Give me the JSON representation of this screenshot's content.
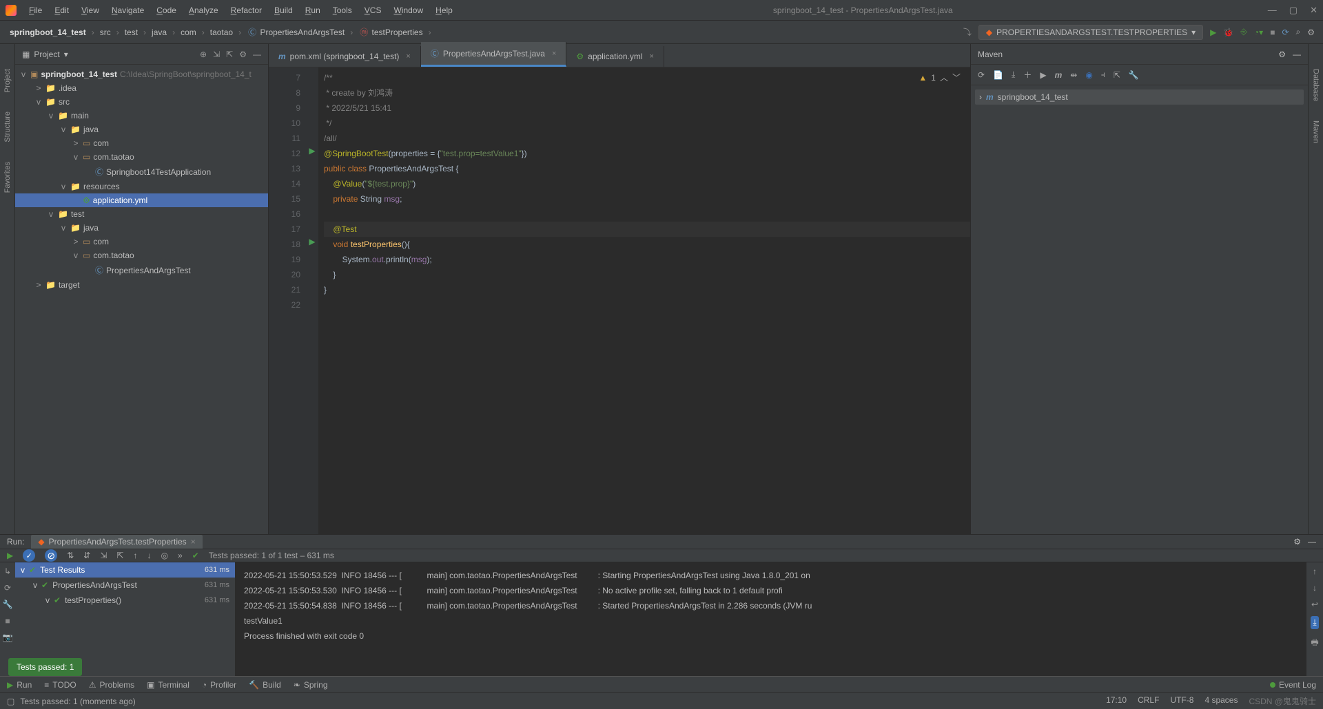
{
  "menu": [
    "File",
    "Edit",
    "View",
    "Navigate",
    "Code",
    "Analyze",
    "Refactor",
    "Build",
    "Run",
    "Tools",
    "VCS",
    "Window",
    "Help"
  ],
  "window_title": "springboot_14_test - PropertiesAndArgsTest.java",
  "breadcrumbs": [
    "springboot_14_test",
    "src",
    "test",
    "java",
    "com",
    "taotao",
    "PropertiesAndArgsTest",
    "testProperties"
  ],
  "run_config": "PROPERTIESANDARGSTEST.TESTPROPERTIES",
  "project": {
    "title": "Project",
    "root": {
      "name": "springboot_14_test",
      "path": "C:\\Idea\\SpringBoot\\springboot_14_t"
    },
    "nodes": [
      {
        "depth": 1,
        "arr": ">",
        "icon": "fldr",
        "label": ".idea"
      },
      {
        "depth": 1,
        "arr": "v",
        "icon": "fldb",
        "label": "src"
      },
      {
        "depth": 2,
        "arr": "v",
        "icon": "fldb",
        "label": "main"
      },
      {
        "depth": 3,
        "arr": "v",
        "icon": "fldb",
        "label": "java"
      },
      {
        "depth": 4,
        "arr": ">",
        "icon": "pkg",
        "label": "com"
      },
      {
        "depth": 4,
        "arr": "v",
        "icon": "pkg",
        "label": "com.taotao"
      },
      {
        "depth": 5,
        "arr": "",
        "icon": "cls",
        "label": "Springboot14TestApplication"
      },
      {
        "depth": 3,
        "arr": "v",
        "icon": "fldr",
        "label": "resources"
      },
      {
        "depth": 4,
        "arr": "",
        "icon": "yml",
        "label": "application.yml",
        "sel": true
      },
      {
        "depth": 2,
        "arr": "v",
        "icon": "fldb",
        "label": "test"
      },
      {
        "depth": 3,
        "arr": "v",
        "icon": "fldb",
        "label": "java"
      },
      {
        "depth": 4,
        "arr": ">",
        "icon": "pkg",
        "label": "com"
      },
      {
        "depth": 4,
        "arr": "v",
        "icon": "pkg",
        "label": "com.taotao"
      },
      {
        "depth": 5,
        "arr": "",
        "icon": "cls",
        "label": "PropertiesAndArgsTest"
      },
      {
        "depth": 1,
        "arr": ">",
        "icon": "fldr",
        "label": "target"
      }
    ]
  },
  "tabs": [
    {
      "icon": "m",
      "label": "pom.xml (springboot_14_test)",
      "active": false
    },
    {
      "icon": "c",
      "label": "PropertiesAndArgsTest.java",
      "active": true
    },
    {
      "icon": "y",
      "label": "application.yml",
      "active": false
    }
  ],
  "inspection": {
    "warn": "1"
  },
  "code_start": 7,
  "code": [
    {
      "n": 7,
      "run": "",
      "html": "<span class='cmt'>/**</span>"
    },
    {
      "n": 8,
      "run": "",
      "html": "<span class='cmt'> * create by 刘鸿涛</span>"
    },
    {
      "n": 9,
      "run": "",
      "html": "<span class='cmt'> * 2022/5/21 15:41</span>"
    },
    {
      "n": 10,
      "run": "",
      "html": "<span class='cmt'> */</span>"
    },
    {
      "n": 11,
      "run": "",
      "html": "<span class='cmt'>/all/</span>"
    },
    {
      "n": 12,
      "run": "▶",
      "html": "<span class='ann'>@SpringBootTest</span><span class='idn'>(</span><span class='idn'>properties</span><span class='idn'> = {</span><span class='str'>\"test.prop=testValue1\"</span><span class='idn'>})</span>"
    },
    {
      "n": 13,
      "run": "",
      "html": "<span class='kw'>public class </span><span class='idn'>PropertiesAndArgsTest {</span>"
    },
    {
      "n": 14,
      "run": "",
      "html": "    <span class='ann'>@Value</span><span class='idn'>(</span><span class='str'>\"${test.prop}\"</span><span class='idn'>)</span>"
    },
    {
      "n": 15,
      "run": "",
      "html": "    <span class='kw'>private </span><span class='idn'>String </span><span class='fld'>msg</span><span class='idn'>;</span>"
    },
    {
      "n": 16,
      "run": "",
      "html": ""
    },
    {
      "n": 17,
      "run": "",
      "cur": true,
      "html": "    <span class='ann'>@Test</span>"
    },
    {
      "n": 18,
      "run": "▶",
      "html": "    <span class='kw'>void </span><span class='mth'>testProperties</span><span class='idn'>(){</span>"
    },
    {
      "n": 19,
      "run": "",
      "html": "        <span class='idn'>System.</span><span class='fld'>out</span><span class='idn'>.println(</span><span class='fld'>msg</span><span class='idn'>);</span>"
    },
    {
      "n": 20,
      "run": "",
      "html": "    <span class='idn'>}</span>"
    },
    {
      "n": 21,
      "run": "",
      "html": "<span class='idn'>}</span>"
    },
    {
      "n": 22,
      "run": "",
      "html": ""
    }
  ],
  "maven": {
    "title": "Maven",
    "root": "springboot_14_test"
  },
  "run": {
    "label": "Run:",
    "tab": "PropertiesAndArgsTest.testProperties",
    "summary": "Tests passed: 1 of 1 test – 631 ms",
    "tree": [
      {
        "depth": 0,
        "label": "Test Results",
        "time": "631 ms",
        "sel": true
      },
      {
        "depth": 1,
        "label": "PropertiesAndArgsTest",
        "time": "631 ms"
      },
      {
        "depth": 2,
        "label": "testProperties()",
        "time": "631 ms"
      }
    ],
    "console": [
      "2022-05-21 15:50:53.529  INFO 18456 --- [           main] com.taotao.PropertiesAndArgsTest         : Starting PropertiesAndArgsTest using Java 1.8.0_201 on",
      "2022-05-21 15:50:53.530  INFO 18456 --- [           main] com.taotao.PropertiesAndArgsTest         : No active profile set, falling back to 1 default profi",
      "2022-05-21 15:50:54.838  INFO 18456 --- [           main] com.taotao.PropertiesAndArgsTest         : Started PropertiesAndArgsTest in 2.286 seconds (JVM ru",
      "testValue1",
      "",
      "Process finished with exit code 0"
    ]
  },
  "toolstrip": [
    {
      "icon": "▶",
      "label": "Run",
      "color": "#4e9a3d"
    },
    {
      "icon": "≡",
      "label": "TODO"
    },
    {
      "icon": "⚠",
      "label": "Problems"
    },
    {
      "icon": "▣",
      "label": "Terminal"
    },
    {
      "icon": "◔",
      "label": "Profiler"
    },
    {
      "icon": "🔨",
      "label": "Build"
    },
    {
      "icon": "❧",
      "label": "Spring"
    }
  ],
  "eventlog": "Event Log",
  "toast": "Tests passed: 1",
  "status": {
    "msg": "Tests passed: 1 (moments ago)",
    "pos": "17:10",
    "eol": "CRLF",
    "enc": "UTF-8",
    "indent": "4 spaces",
    "brand": "CSDN @鬼鬼骑士"
  },
  "leftstrip": [
    "Project",
    "Structure",
    "Favorites"
  ],
  "rightstrip": [
    "Database",
    "Maven"
  ]
}
